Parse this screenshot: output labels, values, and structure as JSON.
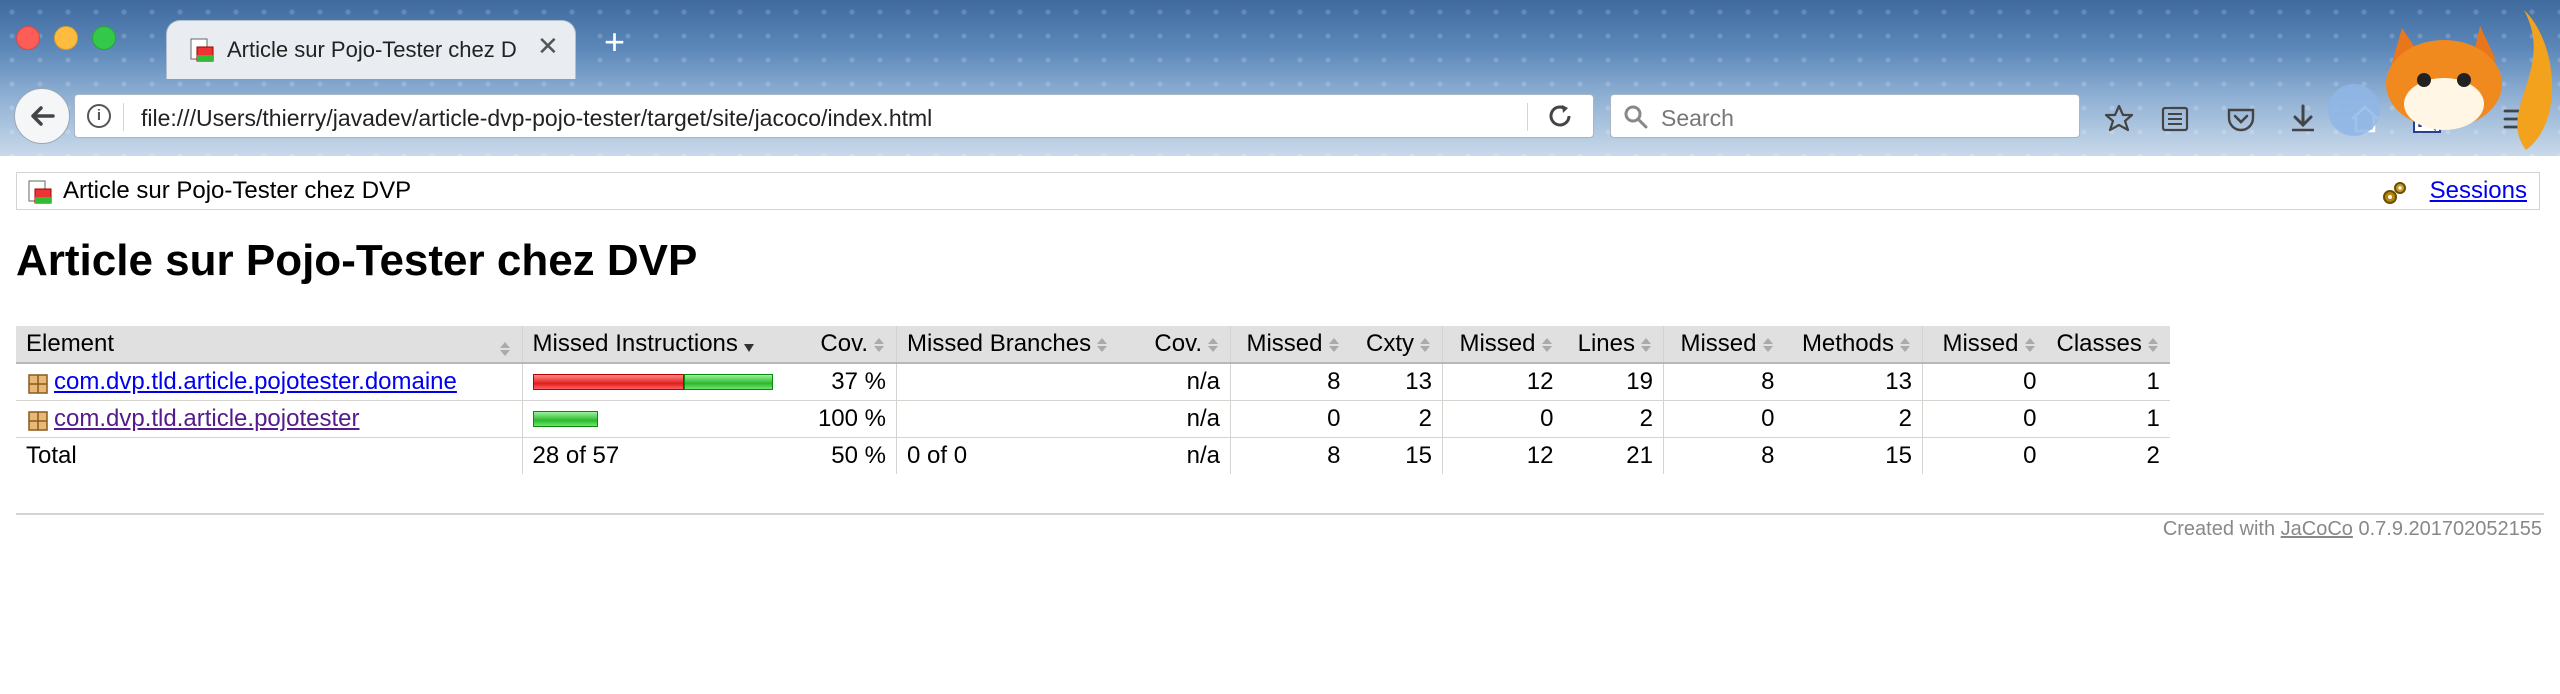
{
  "browser": {
    "tab_title": "Article sur Pojo-Tester chez DVP",
    "tab_close": "✕",
    "new_tab": "+",
    "url": "file:///Users/thierry/javadev/article-dvp-pojo-tester/target/site/jacoco/index.html",
    "search_placeholder": "Search",
    "info_icon_glyph": "i"
  },
  "breadcrumb": {
    "label": "Article sur Pojo-Tester chez DVP",
    "sessions_label": "Sessions"
  },
  "page": {
    "title": "Article sur Pojo-Tester chez DVP"
  },
  "table": {
    "headers": [
      "Element",
      "Missed Instructions",
      "Cov.",
      "Missed Branches",
      "Cov.",
      "Missed",
      "Cxty",
      "Missed",
      "Lines",
      "Missed",
      "Methods",
      "Missed",
      "Classes"
    ],
    "rows": [
      {
        "element": "com.dvp.tld.article.pojotester.domaine",
        "instr_missed_fraction": 0.63,
        "instr_covered_fraction": 0.37,
        "bar_scale": 1.0,
        "instr_cov": "37 %",
        "branches": "",
        "branch_cov": "n/a",
        "cxty_missed": "8",
        "cxty": "13",
        "lines_missed": "12",
        "lines": "19",
        "methods_missed": "8",
        "methods": "13",
        "classes_missed": "0",
        "classes": "1"
      },
      {
        "element": "com.dvp.tld.article.pojotester",
        "instr_missed_fraction": 0.0,
        "instr_covered_fraction": 1.0,
        "bar_scale": 0.27,
        "instr_cov": "100 %",
        "branches": "",
        "branch_cov": "n/a",
        "cxty_missed": "0",
        "cxty": "2",
        "lines_missed": "0",
        "lines": "2",
        "methods_missed": "0",
        "methods": "2",
        "classes_missed": "0",
        "classes": "1"
      }
    ],
    "total": {
      "label": "Total",
      "instr": "28 of 57",
      "instr_cov": "50 %",
      "branches": "0 of 0",
      "branch_cov": "n/a",
      "cxty_missed": "8",
      "cxty": "15",
      "lines_missed": "12",
      "lines": "21",
      "methods_missed": "8",
      "methods": "15",
      "classes_missed": "0",
      "classes": "2"
    }
  },
  "footer": {
    "prefix": "Created with",
    "link": "JaCoCo",
    "version": "0.7.9.201702052155"
  },
  "colors": {
    "link": "#0000ee",
    "visited": "#551a8b",
    "bar_red": "#e11d1d",
    "bar_green": "#2db82d"
  }
}
